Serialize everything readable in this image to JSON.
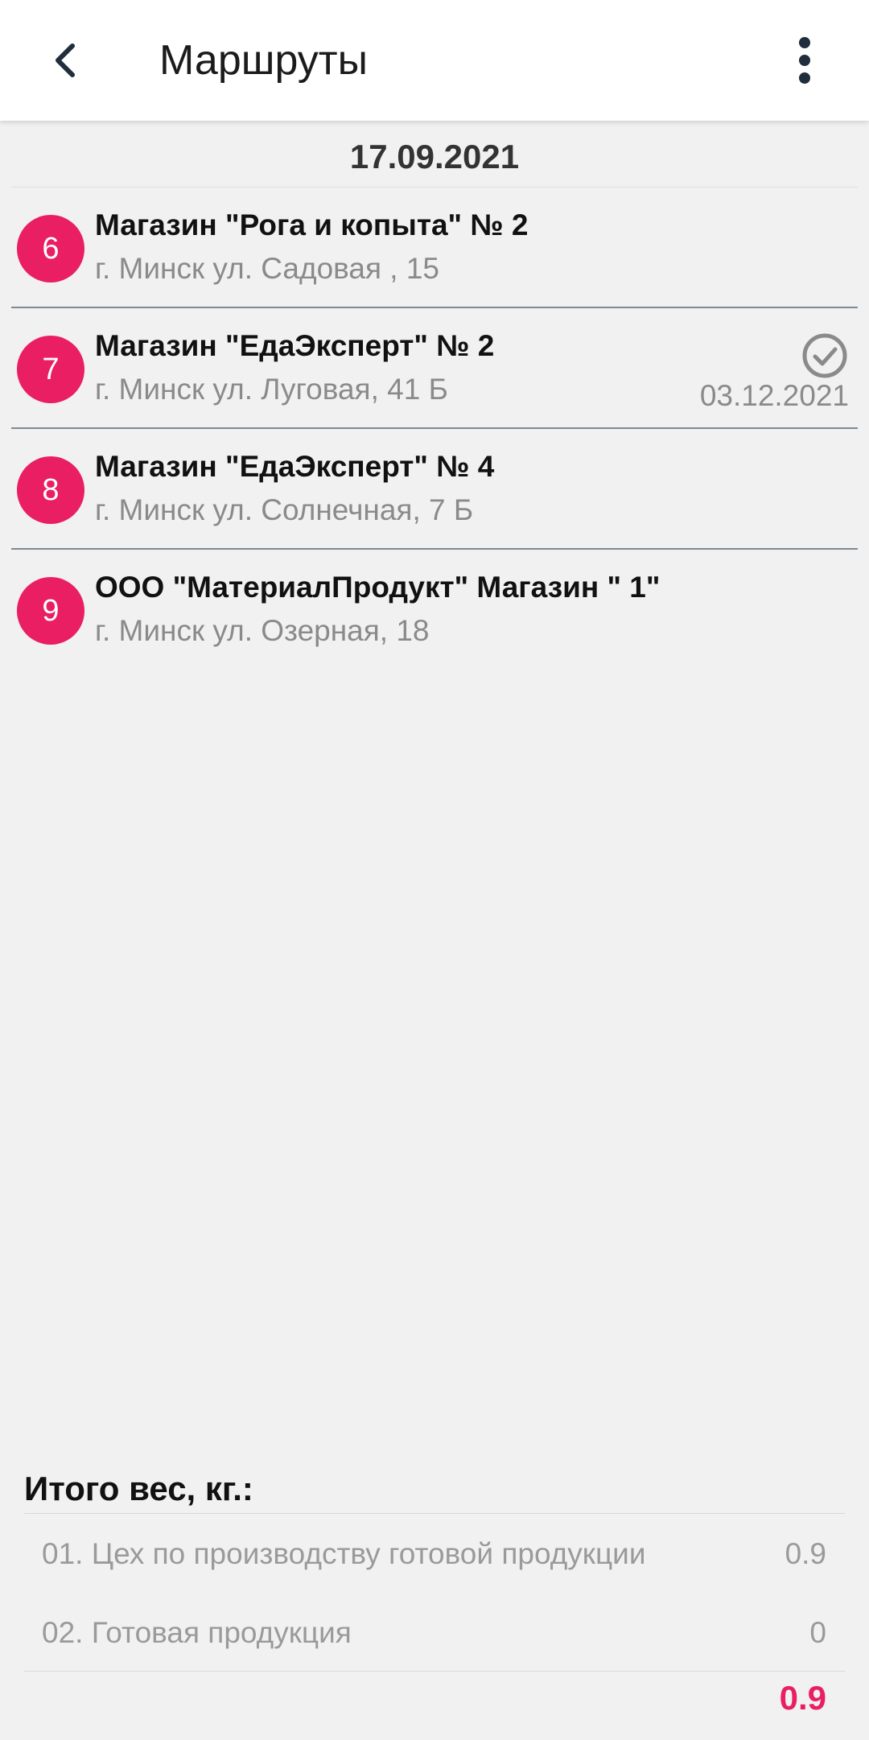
{
  "app_bar": {
    "title": "Маршруты",
    "back_icon": "chevron-left-icon",
    "menu_icon": "more-vert-icon"
  },
  "date": "17.09.2021",
  "routes": [
    {
      "num": "6",
      "name": "Магазин \"Рога и копыта\" № 2",
      "address": "г. Минск ул. Садовая , 15",
      "completed": false,
      "date": ""
    },
    {
      "num": "7",
      "name": "Магазин \"ЕдаЭксперт\" № 2",
      "address": "г. Минск ул. Луговая, 41 Б",
      "completed": true,
      "date": "03.12.2021"
    },
    {
      "num": "8",
      "name": "Магазин \"ЕдаЭксперт\" № 4",
      "address": "г. Минск ул. Солнечная, 7 Б",
      "completed": false,
      "date": ""
    },
    {
      "num": "9",
      "name": "ООО \"МатериалПродукт\" Магазин \" 1\"",
      "address": "г. Минск ул. Озерная, 18",
      "completed": false,
      "date": ""
    }
  ],
  "totals": {
    "title": "Итого вес, кг.:",
    "rows": [
      {
        "label": "01. Цех по производству готовой продукции",
        "value": "0.9"
      },
      {
        "label": "02. Готовая продукция",
        "value": "0"
      }
    ],
    "grand_total": "0.9"
  },
  "colors": {
    "accent": "#e91e63",
    "app_bar_bg": "#ffffff",
    "background": "#f1f1f1",
    "icon": "#1f2d3d",
    "check": "#8a8a8a"
  }
}
